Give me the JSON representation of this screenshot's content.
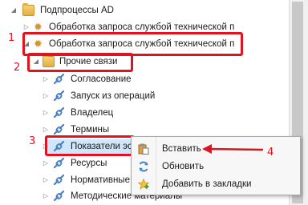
{
  "tree": {
    "items": [
      {
        "label": "Подпроцессы AD",
        "icon": "folder-icon"
      },
      {
        "label": "Обработка запроса службой технической п",
        "icon": "process-gear-icon"
      },
      {
        "label": "Обработка запроса службой технической п",
        "icon": "process-gear-icon"
      },
      {
        "label": "Прочие связи",
        "icon": "folder-icon"
      },
      {
        "label": "Согласование",
        "icon": "link-icon"
      },
      {
        "label": "Запуск из операций",
        "icon": "link-icon"
      },
      {
        "label": "Владелец",
        "icon": "link-icon"
      },
      {
        "label": "Термины",
        "icon": "link-icon"
      },
      {
        "label": "Показатели эс",
        "icon": "link-icon"
      },
      {
        "label": "Ресурсы",
        "icon": "link-icon"
      },
      {
        "label": "Нормативные",
        "icon": "link-icon"
      },
      {
        "label": "Методические материалы",
        "icon": "link-icon"
      }
    ]
  },
  "context_menu": {
    "items": [
      {
        "label": "Вставить",
        "icon": "paste-icon"
      },
      {
        "label": "Обновить",
        "icon": "refresh-icon"
      },
      {
        "label": "Добавить в закладки",
        "icon": "bookmark-star-icon"
      }
    ]
  },
  "annotations": {
    "one": "1",
    "two": "2",
    "three": "3",
    "four": "4"
  },
  "colors": {
    "annotation_red": "#e0141e",
    "selection_blue": "#cfe6fb",
    "folder_gold": "#e3ad3f",
    "link_blue": "#4a7fc0"
  }
}
